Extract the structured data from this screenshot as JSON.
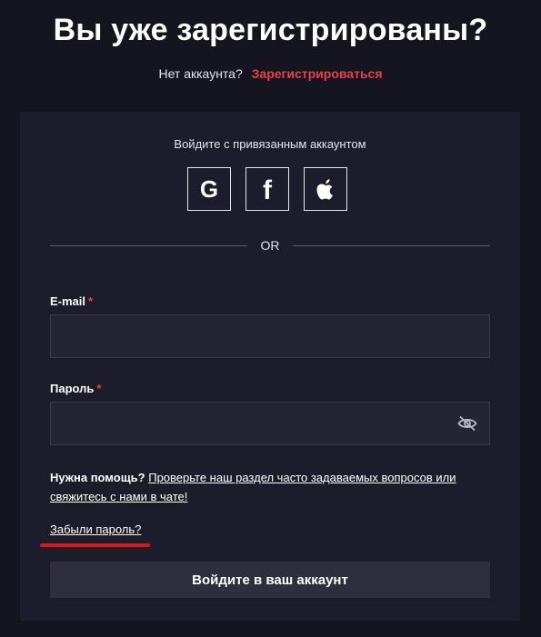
{
  "header": {
    "title": "Вы уже зарегистрированы?",
    "no_account_text": "Нет аккаунта?",
    "register_link": "Зарегистрироваться"
  },
  "social": {
    "caption": "Войдите с привязанным аккаунтом",
    "buttons": [
      {
        "icon": "google-icon",
        "glyph": "G"
      },
      {
        "icon": "facebook-icon",
        "glyph": "f"
      },
      {
        "icon": "apple-icon"
      }
    ],
    "divider_text": "OR"
  },
  "form": {
    "email_label": "E-mail",
    "password_label": "Пароль",
    "required_mark": "*",
    "email_value": "",
    "password_value": ""
  },
  "help": {
    "prefix": "Нужна помощь?",
    "link": "Проверьте наш раздел часто задаваемых вопросов или свяжитесь с нами в чате!"
  },
  "forgot_link": "Забыли пароль?",
  "submit_label": "Войдите в ваш аккаунт",
  "colors": {
    "background": "#151520",
    "card": "#1c1c2a",
    "accent_red": "#e8404b",
    "highlight_underline": "#e0141c"
  }
}
